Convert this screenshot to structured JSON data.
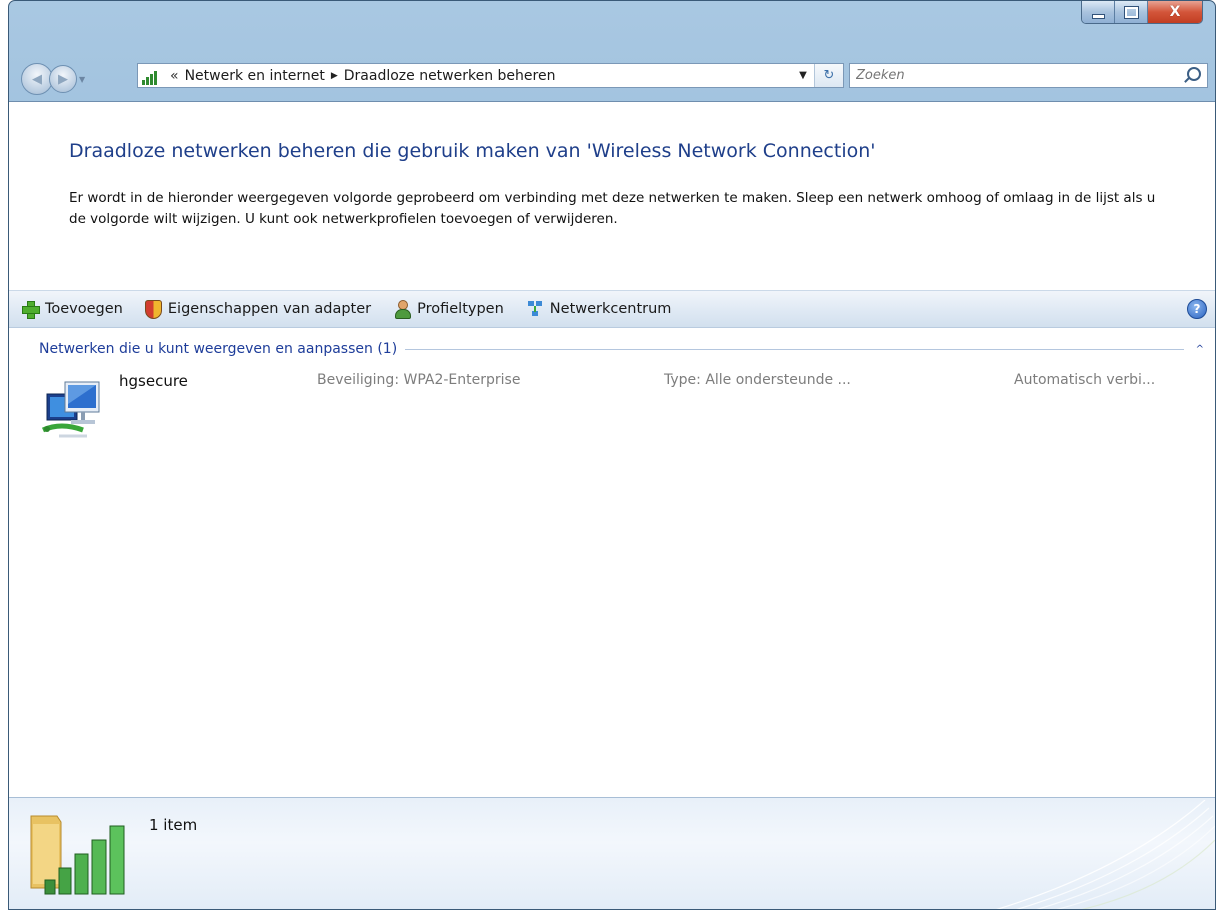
{
  "window": {
    "caption_minimize": "minimize",
    "caption_maximize": "maximize",
    "caption_close": "X"
  },
  "address": {
    "overflow": "«",
    "crumbs": [
      "Netwerk en internet",
      "Draadloze netwerken beheren"
    ]
  },
  "search": {
    "placeholder": "Zoeken"
  },
  "page": {
    "title": "Draadloze netwerken beheren die gebruik maken van 'Wireless Network Connection'",
    "description": "Er wordt in de hieronder weergegeven volgorde geprobeerd om verbinding met deze netwerken te maken. Sleep een netwerk omhoog of omlaag in de lijst als u de volgorde wilt wijzigen. U kunt ook netwerkprofielen toevoegen of verwijderen."
  },
  "toolbar": {
    "items": [
      {
        "label": "Toevoegen",
        "icon": "plus-icon"
      },
      {
        "label": "Eigenschappen van adapter",
        "icon": "shield-icon"
      },
      {
        "label": "Profieltypen",
        "icon": "person-icon"
      },
      {
        "label": "Netwerkcentrum",
        "icon": "network-center-icon"
      }
    ],
    "help_label": "?"
  },
  "group": {
    "label": "Netwerken die u kunt weergeven en aanpassen (1)",
    "collapse_glyph": "^"
  },
  "networks": [
    {
      "name": "hgsecure",
      "security": "Beveiliging: WPA2-Enterprise",
      "type": "Type: Alle ondersteunde ...",
      "connect": "Automatisch verbi..."
    }
  ],
  "details": {
    "count": "1 item"
  },
  "colors": {
    "title_blue": "#1f3f8a",
    "group_blue": "#1e3d9a",
    "muted_text": "#7d7d7d",
    "frame": "#8db4d6"
  }
}
